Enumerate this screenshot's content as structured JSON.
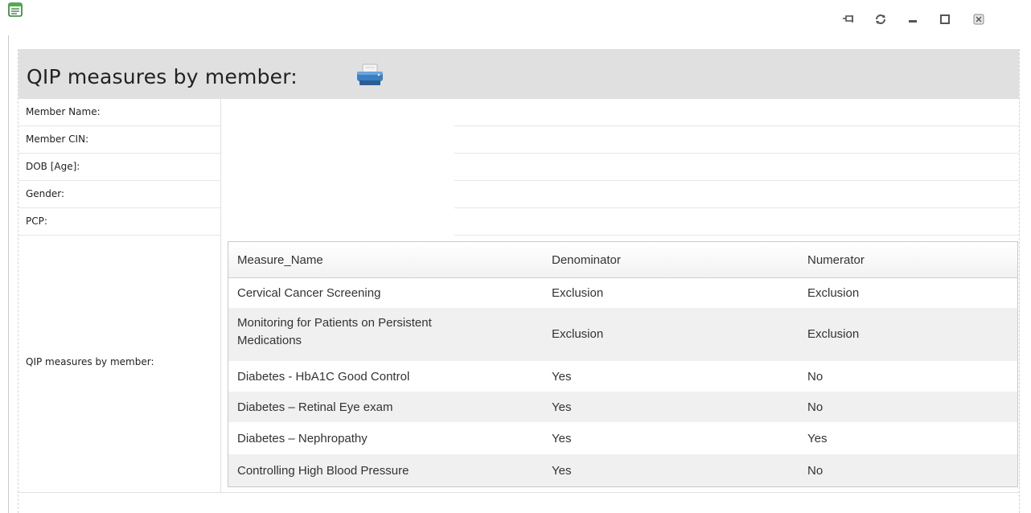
{
  "window": {
    "icons": {
      "app": "list-document-icon",
      "pin": "pin-icon",
      "refresh": "refresh-icon",
      "minimize": "minimize-icon",
      "maximize": "maximize-icon",
      "close": "close-icon"
    }
  },
  "header": {
    "title": "QIP measures by member:",
    "print_icon": "printer-icon"
  },
  "member_info": {
    "name_label": "Member Name:",
    "cin_label": "Member CIN:",
    "dob_label": "DOB [Age]:",
    "gender_label": "Gender:",
    "pcp_label": "PCP:"
  },
  "measures": {
    "label": "QIP measures by member:",
    "columns": [
      "Measure_Name",
      "Denominator",
      "Numerator"
    ],
    "rows": [
      {
        "measure": "Cervical Cancer Screening",
        "denominator": "Exclusion",
        "numerator": "Exclusion"
      },
      {
        "measure_line1": "Monitoring for Patients on Persistent",
        "measure_line2": "Medications",
        "denominator": "Exclusion",
        "numerator": "Exclusion"
      },
      {
        "measure": "Diabetes - HbA1C Good Control",
        "denominator": "Yes",
        "numerator": "No"
      },
      {
        "measure": "Diabetes – Retinal Eye exam",
        "denominator": "Yes",
        "numerator": "No"
      },
      {
        "measure": "Diabetes – Nephropathy",
        "denominator": "Yes",
        "numerator": "Yes"
      },
      {
        "measure": "Controlling High Blood Pressure",
        "denominator": "Yes",
        "numerator": "No"
      }
    ]
  },
  "colors": {
    "header_bg": "#e0e0e0",
    "alt_row_bg": "#f0f0f0",
    "print_icon_blue": "#2f6fb0"
  }
}
